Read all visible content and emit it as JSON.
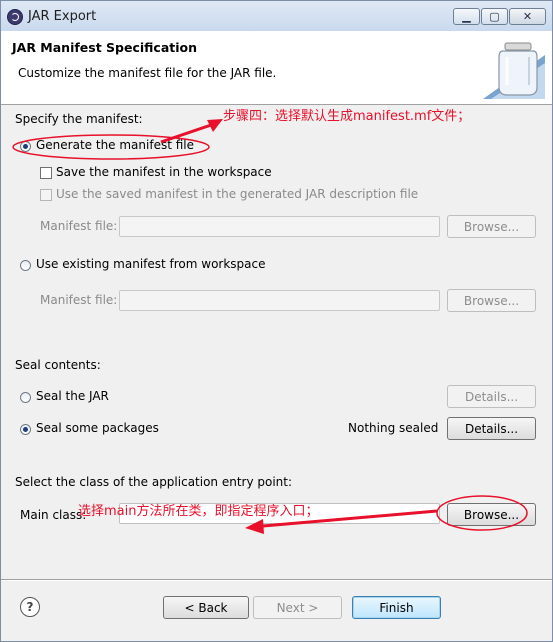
{
  "window": {
    "title": "JAR Export",
    "controls": {
      "minimize": "▁",
      "maximize": "▢",
      "close": "✕"
    }
  },
  "banner": {
    "title": "JAR Manifest Specification",
    "description": "Customize the manifest file for the JAR file.",
    "icon": "jar-icon"
  },
  "manifest": {
    "section_label": "Specify the manifest:",
    "generate_label": "Generate the manifest file",
    "generate_selected": true,
    "save_label": "Save the manifest in the workspace",
    "use_saved_label": "Use the saved manifest in the generated JAR description file",
    "file_label_1": "Manifest file:",
    "browse_1": "Browse...",
    "use_existing_label": "Use existing manifest from workspace",
    "file_label_2": "Manifest file:",
    "browse_2": "Browse..."
  },
  "seal": {
    "section_label": "Seal contents:",
    "seal_jar_label": "Seal the JAR",
    "details_1": "Details...",
    "seal_packages_label": "Seal some packages",
    "seal_packages_selected": true,
    "status": "Nothing sealed",
    "details_2": "Details..."
  },
  "entry": {
    "section_label": "Select the class of the application entry point:",
    "main_class_label": "Main class:",
    "browse": "Browse..."
  },
  "annotations": {
    "step4": "步骤四：选择默认生成manifest.mf文件；",
    "main_class_note": "选择main方法所在类，即指定程序入口；",
    "color": "#e8102a"
  },
  "footer": {
    "back": "< Back",
    "next": "Next >",
    "finish": "Finish"
  }
}
